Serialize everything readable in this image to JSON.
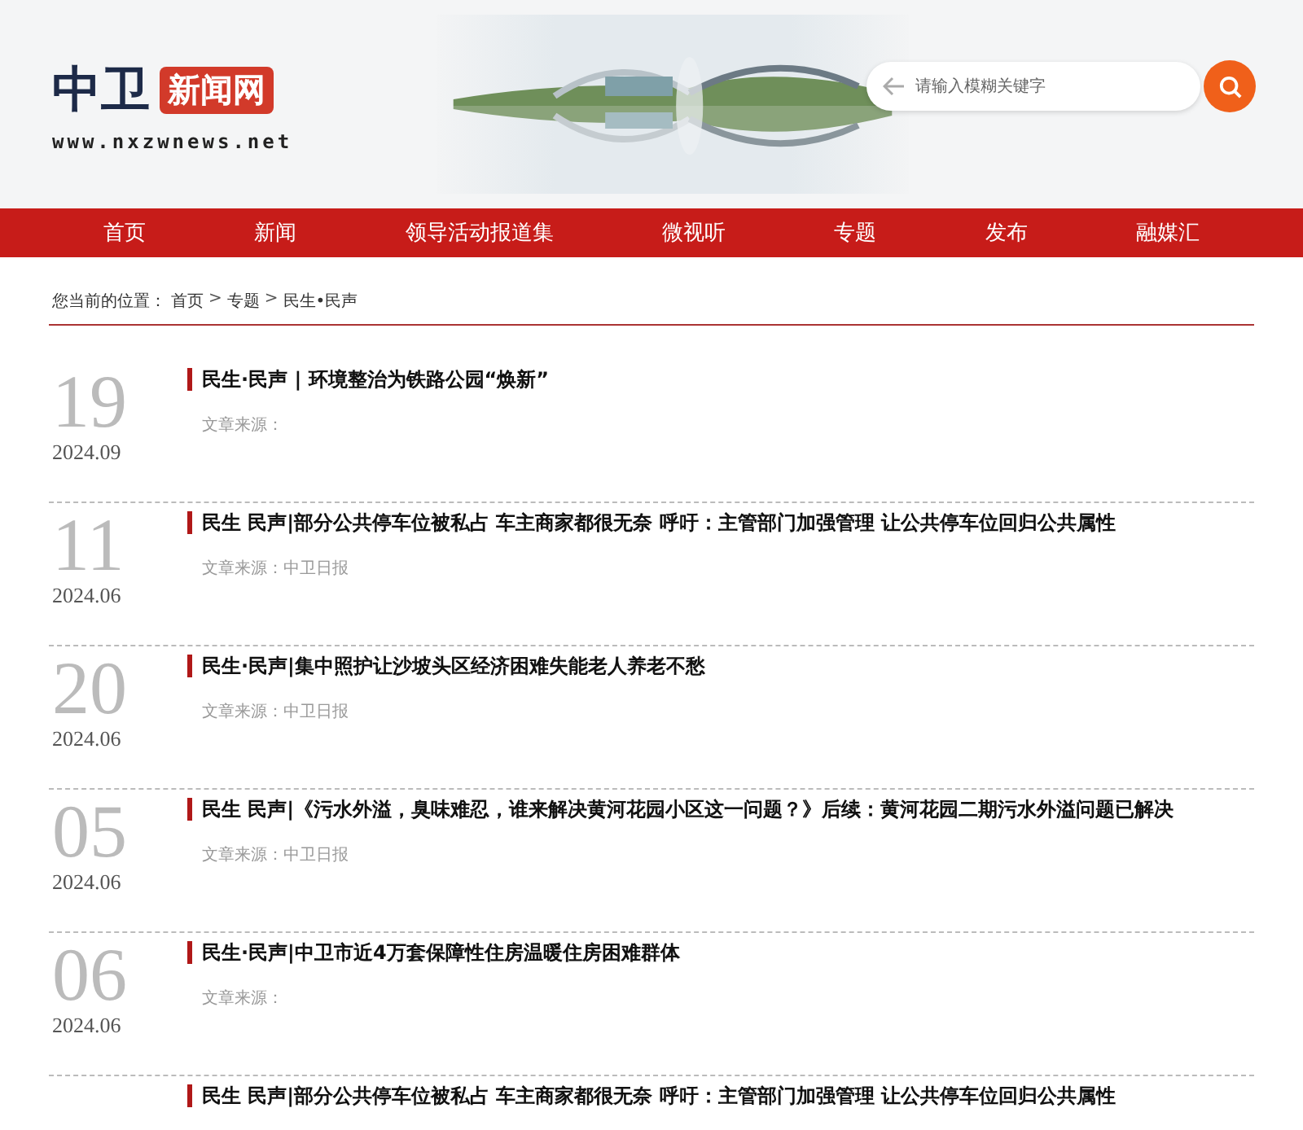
{
  "logo": {
    "name": "中卫",
    "badge": "新闻网",
    "url": "www.nxzwnews.net"
  },
  "search": {
    "placeholder": "请输入模糊关键字"
  },
  "nav": [
    {
      "label": "首页"
    },
    {
      "label": "新闻"
    },
    {
      "label": "领导活动报道集"
    },
    {
      "label": "微视听"
    },
    {
      "label": "专题"
    },
    {
      "label": "发布"
    },
    {
      "label": "融媒汇"
    }
  ],
  "breadcrumb": {
    "label": "您当前的位置：",
    "path": [
      "首页",
      "专题",
      "民生•民声"
    ],
    "separator": ">"
  },
  "articles": [
    {
      "day": "19",
      "month": "2024.09",
      "title": "民生·民声 | 环境整治为铁路公园“焕新”",
      "source": "文章来源："
    },
    {
      "day": "11",
      "month": "2024.06",
      "title": "民生 民声|部分公共停车位被私占 车主商家都很无奈 呼吁：主管部门加强管理 让公共停车位回归公共属性",
      "source": "文章来源：中卫日报"
    },
    {
      "day": "20",
      "month": "2024.06",
      "title": "民生·民声|集中照护让沙坡头区经济困难失能老人养老不愁",
      "source": "文章来源：中卫日报"
    },
    {
      "day": "05",
      "month": "2024.06",
      "title": "民生 民声|《污水外溢，臭味难忍，谁来解决黄河花园小区这一问题？》后续：黄河花园二期污水外溢问题已解决",
      "source": "文章来源：中卫日报"
    },
    {
      "day": "06",
      "month": "2024.06",
      "title": "民生·民声|中卫市近4万套保障性住房温暖住房困难群体",
      "source": "文章来源："
    },
    {
      "title": "民生 民声|部分公共停车位被私占 车主商家都很无奈 呼吁：主管部门加强管理 让公共停车位回归公共属性"
    }
  ]
}
